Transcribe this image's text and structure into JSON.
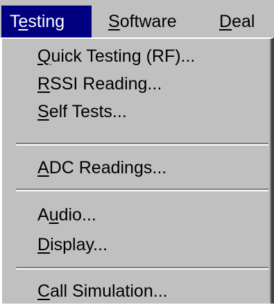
{
  "menubar": {
    "items": [
      {
        "pre": "T",
        "key": "e",
        "post": "sting",
        "active": true
      },
      {
        "pre": "",
        "key": "S",
        "post": "oftware",
        "active": false
      },
      {
        "pre": "",
        "key": "D",
        "post": "eal",
        "active": false
      }
    ]
  },
  "dropdown": {
    "items": [
      {
        "pre": "",
        "key": "Q",
        "post": "uick Testing (RF)..."
      },
      {
        "pre": "",
        "key": "R",
        "post": "SSI Reading..."
      },
      {
        "pre": "",
        "key": "S",
        "post": "elf Tests..."
      },
      {
        "pre": "",
        "key": "A",
        "post": "DC Readings..."
      },
      {
        "pre": "A",
        "key": "u",
        "post": "dio..."
      },
      {
        "pre": "",
        "key": "D",
        "post": "isplay..."
      },
      {
        "pre": "",
        "key": "C",
        "post": "all Simulation..."
      }
    ]
  },
  "colors": {
    "menu_bg": "#c0c0c0",
    "highlight_bg": "#000080",
    "highlight_text": "#ffffff",
    "separator_shadow": "#808080"
  }
}
